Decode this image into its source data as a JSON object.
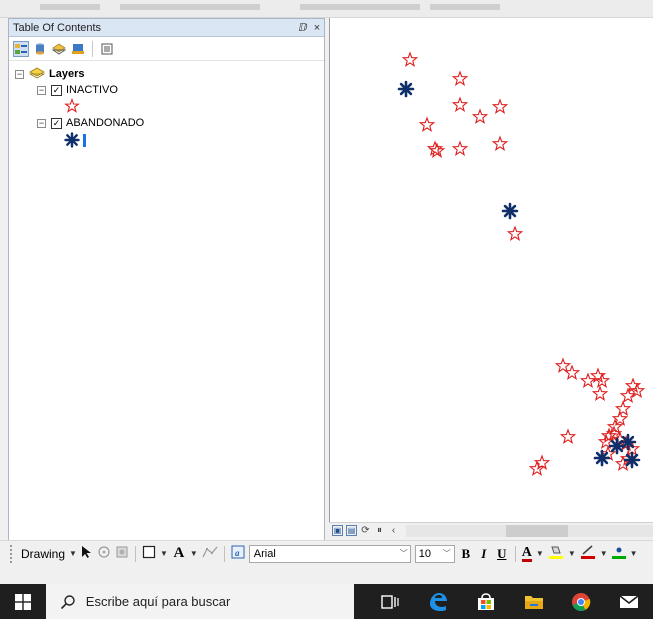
{
  "toc": {
    "title": "Table Of Contents",
    "pin_glyph": "ⅅ",
    "close_glyph": "×",
    "tools": [
      "list-by-drawing-order-icon",
      "list-by-source-icon",
      "list-by-visibility-icon",
      "list-by-selection-icon",
      "options-icon"
    ],
    "layers_group": {
      "label": "Layers",
      "expanded": true
    },
    "layers": [
      {
        "label": "INACTIVO",
        "checked": true,
        "symbol": "red-star-icon",
        "symbol_color": "#e02020"
      },
      {
        "label": "ABANDONADO",
        "checked": true,
        "symbol": "navy-asterisk-icon",
        "symbol_color": "#0f2f6a"
      }
    ]
  },
  "map": {
    "background": "#ffffff",
    "inactivo_color": "#e02020",
    "abandonado_color": "#0f2f6a"
  },
  "map_bar": {
    "buttons": [
      "data-view-icon",
      "layout-view-icon",
      "refresh-icon",
      "pause-icon",
      "scroll-left-icon"
    ]
  },
  "drawing_toolbar": {
    "label": "Drawing",
    "font_name": "Arial",
    "font_size": "10",
    "bold": "B",
    "italic": "I",
    "underline": "U",
    "font_color_letter": "A",
    "text_tool_letter": "A",
    "font_color": "#c00000",
    "fill_color": "#ffff00",
    "line_color": "#d40000",
    "marker_color": "#00aa00"
  },
  "taskbar": {
    "search_placeholder": "Escribe aquí para buscar",
    "apps": [
      "task-view-icon",
      "edge-icon",
      "store-icon",
      "file-explorer-icon",
      "chrome-icon",
      "mail-icon"
    ]
  }
}
